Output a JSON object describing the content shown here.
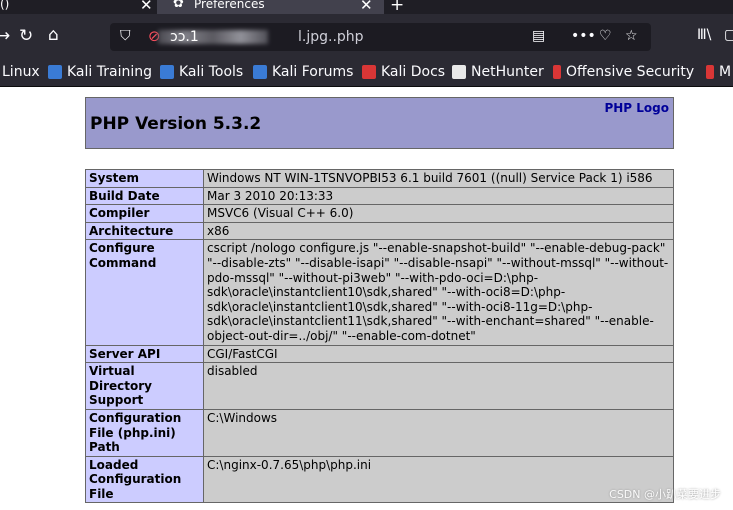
{
  "tabs": {
    "prev_tab_fragment": "()",
    "active_title": "Preferences"
  },
  "nav": {
    "url_visible": "l.jpg..php",
    "url_prefix": "ɔɔ.1"
  },
  "bookmarks": [
    {
      "label": "Linux",
      "color": "#2b2a33"
    },
    {
      "label": "Kali Training",
      "color": "#3a7bd5"
    },
    {
      "label": "Kali Tools",
      "color": "#3a7bd5"
    },
    {
      "label": "Kali Forums",
      "color": "#3a7bd5"
    },
    {
      "label": "Kali Docs",
      "color": "#d93636"
    },
    {
      "label": "NetHunter",
      "color": "#e8e8e8"
    },
    {
      "label": "Offensive Security",
      "color": "#d93636"
    },
    {
      "label": "M",
      "color": "#d93636"
    }
  ],
  "php": {
    "version_title": "PHP Version 5.3.2",
    "logo_text": "PHP Logo",
    "rows": [
      {
        "key": "System",
        "value": "Windows NT WIN-1TSNVOPBI53 6.1 build 7601 ((null) Service Pack 1) i586"
      },
      {
        "key": "Build Date",
        "value": "Mar 3 2010 20:13:33"
      },
      {
        "key": "Compiler",
        "value": "MSVC6 (Visual C++ 6.0)"
      },
      {
        "key": "Architecture",
        "value": "x86"
      },
      {
        "key": "Configure Command",
        "value": "cscript /nologo configure.js \"--enable-snapshot-build\" \"--enable-debug-pack\" \"--disable-zts\" \"--disable-isapi\" \"--disable-nsapi\" \"--without-mssql\" \"--without-pdo-mssql\" \"--without-pi3web\" \"--with-pdo-oci=D:\\php-sdk\\oracle\\instantclient10\\sdk,shared\" \"--with-oci8=D:\\php-sdk\\oracle\\instantclient10\\sdk,shared\" \"--with-oci8-11g=D:\\php-sdk\\oracle\\instantclient11\\sdk,shared\" \"--with-enchant=shared\" \"--enable-object-out-dir=../obj/\" \"--enable-com-dotnet\""
      },
      {
        "key": "Server API",
        "value": "CGI/FastCGI"
      },
      {
        "key": "Virtual Directory Support",
        "value": "disabled"
      },
      {
        "key": "Configuration File (php.ini) Path",
        "value": "C:\\Windows"
      },
      {
        "key": "Loaded Configuration File",
        "value": "C:\\nginx-0.7.65\\php\\php.ini"
      }
    ]
  },
  "watermark": "CSDN @小趴菜要进步"
}
